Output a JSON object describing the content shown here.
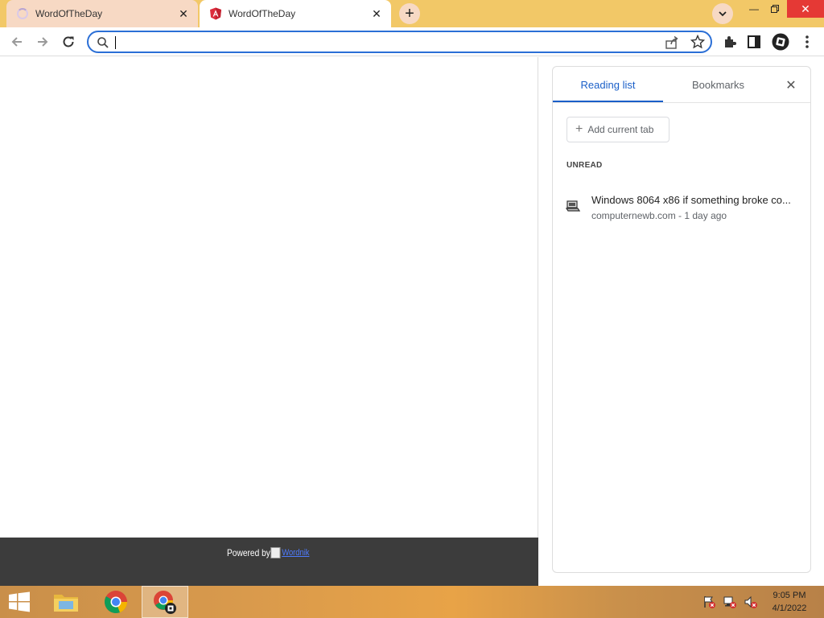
{
  "browser": {
    "tabs": [
      {
        "title": "WordOfTheDay",
        "state": "loading"
      },
      {
        "title": "WordOfTheDay",
        "state": "active",
        "favicon": "angular-icon"
      }
    ],
    "new_tab_label": "+",
    "omnibox": {
      "value": "",
      "placeholder": ""
    }
  },
  "page": {
    "footer_powered_by": "Powered by",
    "footer_link": "Wordnik"
  },
  "side_panel": {
    "tabs": [
      "Reading list",
      "Bookmarks"
    ],
    "active_tab": "Reading list",
    "add_current_tab": "Add current tab",
    "section_label": "UNREAD",
    "items": [
      {
        "title": "Windows 8064 x86 if something broke co...",
        "meta": "computernewb.com - 1 day ago",
        "icon": "computer-icon"
      }
    ]
  },
  "taskbar": {
    "clock_time": "9:05 PM",
    "clock_date": "4/1/2022"
  },
  "colors": {
    "titlebar": "#f2c867",
    "accent_blue": "#1a5fc8",
    "footer_bg": "#3c3c3c"
  }
}
